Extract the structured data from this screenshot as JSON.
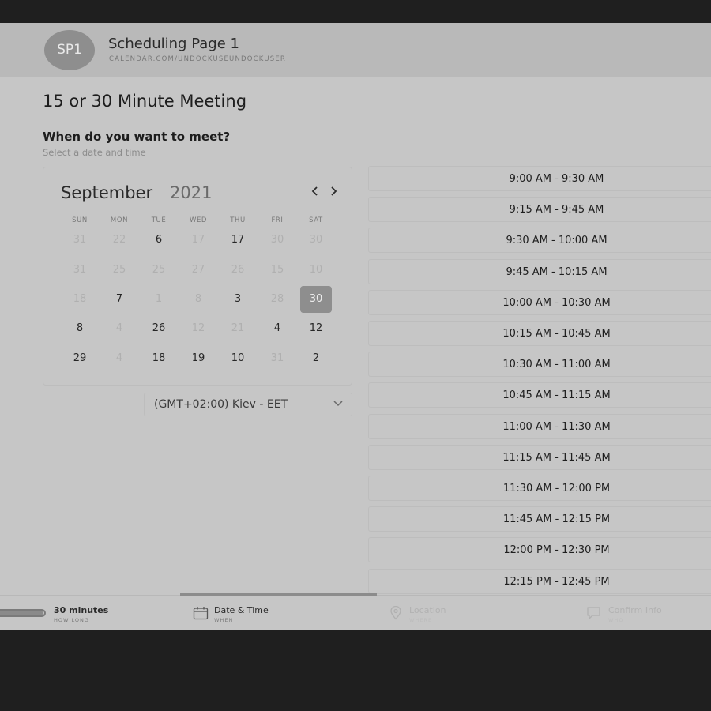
{
  "header": {
    "avatar_initials": "SP1",
    "title": "Scheduling Page 1",
    "url": "CALENDAR.COM/UNDOCKUSEUNDOCKUSER"
  },
  "meeting_title": "15 or 30 Minute Meeting",
  "when": {
    "title": "When do you want to meet?",
    "subtitle": "Select a date and time"
  },
  "calendar": {
    "month": "September",
    "year": "2021",
    "prev_icon": "chevron-left-icon",
    "next_icon": "chevron-right-icon",
    "weekdays": [
      "SUN",
      "MON",
      "TUE",
      "WED",
      "THU",
      "FRI",
      "SAT"
    ],
    "weeks": [
      [
        {
          "d": "31",
          "a": false
        },
        {
          "d": "22",
          "a": false
        },
        {
          "d": "6",
          "a": true
        },
        {
          "d": "17",
          "a": false
        },
        {
          "d": "17",
          "a": true
        },
        {
          "d": "30",
          "a": false
        },
        {
          "d": "30",
          "a": false
        }
      ],
      [
        {
          "d": "31",
          "a": false
        },
        {
          "d": "25",
          "a": false
        },
        {
          "d": "25",
          "a": false
        },
        {
          "d": "27",
          "a": false
        },
        {
          "d": "26",
          "a": false
        },
        {
          "d": "15",
          "a": false
        },
        {
          "d": "10",
          "a": false
        }
      ],
      [
        {
          "d": "18",
          "a": false
        },
        {
          "d": "7",
          "a": true
        },
        {
          "d": "1",
          "a": false
        },
        {
          "d": "8",
          "a": false
        },
        {
          "d": "3",
          "a": true
        },
        {
          "d": "28",
          "a": false
        },
        {
          "d": "30",
          "a": true,
          "selected": true
        }
      ],
      [
        {
          "d": "8",
          "a": true
        },
        {
          "d": "4",
          "a": false
        },
        {
          "d": "26",
          "a": true
        },
        {
          "d": "12",
          "a": false
        },
        {
          "d": "21",
          "a": false
        },
        {
          "d": "4",
          "a": true
        },
        {
          "d": "12",
          "a": true
        }
      ],
      [
        {
          "d": "29",
          "a": true
        },
        {
          "d": "4",
          "a": false
        },
        {
          "d": "18",
          "a": true
        },
        {
          "d": "19",
          "a": true
        },
        {
          "d": "10",
          "a": true
        },
        {
          "d": "31",
          "a": false
        },
        {
          "d": "2",
          "a": true
        }
      ]
    ]
  },
  "timezone": {
    "value": "(GMT+02:00) Kiev - EET",
    "icon": "chevron-down-icon"
  },
  "time_slots": [
    "9:00 AM - 9:30 AM",
    "9:15 AM - 9:45 AM",
    "9:30 AM - 10:00 AM",
    "9:45 AM - 10:15 AM",
    "10:00 AM - 10:30 AM",
    "10:15 AM - 10:45 AM",
    "10:30 AM - 11:00 AM",
    "10:45 AM - 11:15 AM",
    "11:00 AM - 11:30 AM",
    "11:15 AM - 11:45 AM",
    "11:30 AM - 12:00 PM",
    "11:45 AM - 12:15 PM",
    "12:00 PM - 12:30 PM",
    "12:15 PM - 12:45 PM"
  ],
  "tabs": {
    "duration": {
      "label": "30 minutes",
      "sub": "HOW LONG",
      "icon": "progress-bar-icon"
    },
    "datetime": {
      "label": "Date & Time",
      "sub": "WHEN",
      "icon": "calendar-icon",
      "active": true
    },
    "location": {
      "label": "Location",
      "sub": "WHERE",
      "icon": "map-pin-icon"
    },
    "confirm": {
      "label": "Confirm Info",
      "sub": "WHO",
      "icon": "chat-icon"
    }
  }
}
